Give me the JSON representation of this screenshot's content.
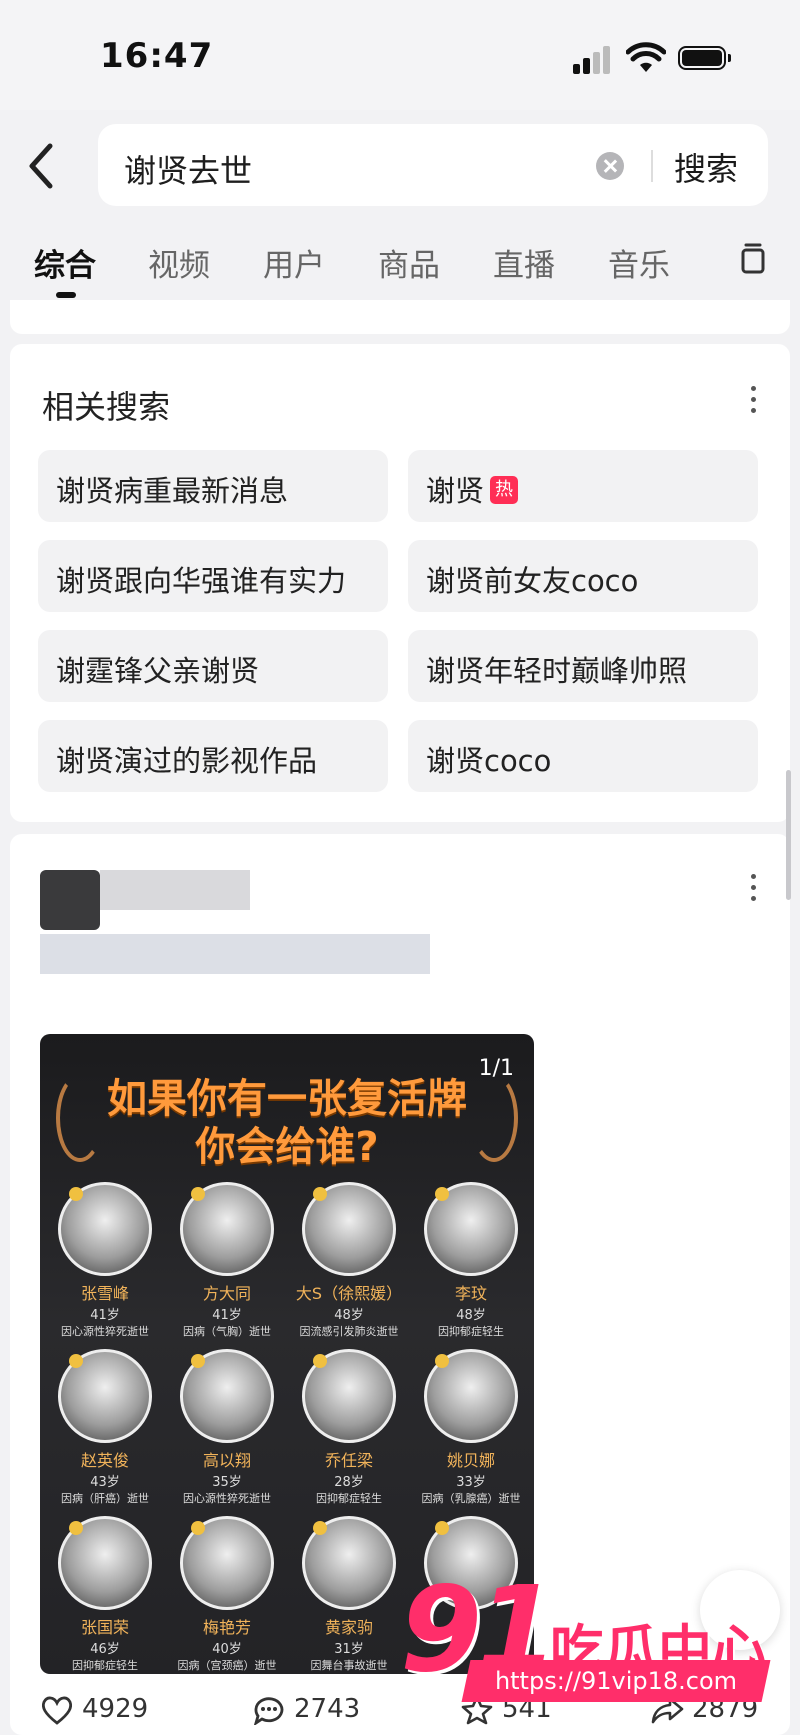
{
  "status_bar": {
    "time": "16:47"
  },
  "search": {
    "query": "谢贤去世",
    "button_label": "搜索"
  },
  "tabs": [
    {
      "label": "综合",
      "active": true
    },
    {
      "label": "视频",
      "active": false
    },
    {
      "label": "用户",
      "active": false
    },
    {
      "label": "商品",
      "active": false
    },
    {
      "label": "直播",
      "active": false
    },
    {
      "label": "音乐",
      "active": false
    }
  ],
  "related": {
    "title": "相关搜索",
    "items": [
      {
        "label": "谢贤病重最新消息"
      },
      {
        "label": "谢贤",
        "badge": "热"
      },
      {
        "label": "谢贤跟向华强谁有实力"
      },
      {
        "label": "谢贤前女友coco"
      },
      {
        "label": "谢霆锋父亲谢贤"
      },
      {
        "label": "谢贤年轻时巅峰帅照"
      },
      {
        "label": "谢贤演过的影视作品"
      },
      {
        "label": "谢贤coco"
      }
    ]
  },
  "post": {
    "image": {
      "count": "1/1",
      "title_line1": "如果你有一张复活牌",
      "title_line2": "你会给谁?",
      "people": [
        {
          "name": "张雪峰",
          "age": "41岁",
          "cause": "因心源性猝死逝世"
        },
        {
          "name": "方大同",
          "age": "41岁",
          "cause": "因病（气胸）逝世"
        },
        {
          "name": "大S（徐熙媛）",
          "age": "48岁",
          "cause": "因流感引发肺炎逝世"
        },
        {
          "name": "李玟",
          "age": "48岁",
          "cause": "因抑郁症轻生"
        },
        {
          "name": "赵英俊",
          "age": "43岁",
          "cause": "因病（肝癌）逝世"
        },
        {
          "name": "高以翔",
          "age": "35岁",
          "cause": "因心源性猝死逝世"
        },
        {
          "name": "乔任梁",
          "age": "28岁",
          "cause": "因抑郁症轻生"
        },
        {
          "name": "姚贝娜",
          "age": "33岁",
          "cause": "因病（乳腺癌）逝世"
        },
        {
          "name": "张国荣",
          "age": "46岁",
          "cause": "因抑郁症轻生"
        },
        {
          "name": "梅艳芳",
          "age": "40岁",
          "cause": "因病（宫颈癌）逝世"
        },
        {
          "name": "黄家驹",
          "age": "31岁",
          "cause": "因舞台事故逝世"
        }
      ]
    },
    "stats": {
      "likes": "4929",
      "comments": "2743",
      "favorites": "541",
      "shares": "2879"
    }
  },
  "watermark": {
    "brand_number": "91",
    "brand_text": "吃瓜中心",
    "url": "https://91vip18.com"
  }
}
